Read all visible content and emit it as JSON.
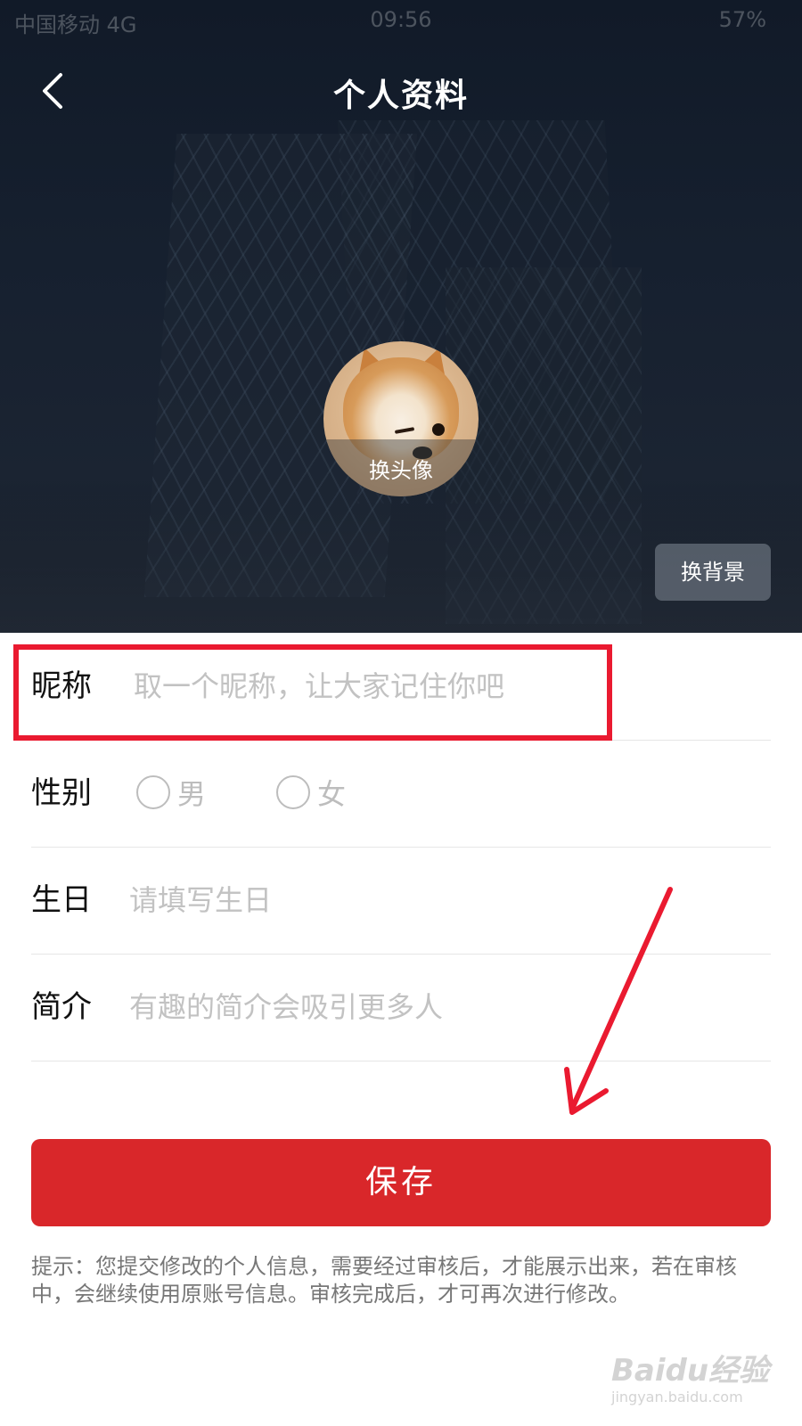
{
  "status_bar": {
    "carrier": "中国移动  4G",
    "time": "09:56",
    "battery": "57%"
  },
  "header": {
    "title": "个人资料",
    "back_icon": "chevron-left-icon"
  },
  "avatar": {
    "caption": "换头像"
  },
  "background": {
    "change_label": "换背景"
  },
  "form": {
    "nickname": {
      "label": "昵称",
      "placeholder": "取一个昵称，让大家记住你吧",
      "value": ""
    },
    "gender": {
      "label": "性别",
      "options": [
        {
          "label": "男",
          "selected": false
        },
        {
          "label": "女",
          "selected": false
        }
      ]
    },
    "birthday": {
      "label": "生日",
      "placeholder": "请填写生日",
      "value": ""
    },
    "bio": {
      "label": "简介",
      "placeholder": "有趣的简介会吸引更多人",
      "value": ""
    }
  },
  "save_label": "保存",
  "hint": "提示：您提交修改的个人信息，需要经过审核后，才能展示出来，若在审核中，会继续使用原账号信息。审核完成后，才可再次进行修改。",
  "annotation": {
    "highlight_color": "#ea1a30"
  },
  "watermark": {
    "logo": "Baidu经验",
    "url": "jingyan.baidu.com"
  },
  "colors": {
    "accent": "#d9272a"
  }
}
